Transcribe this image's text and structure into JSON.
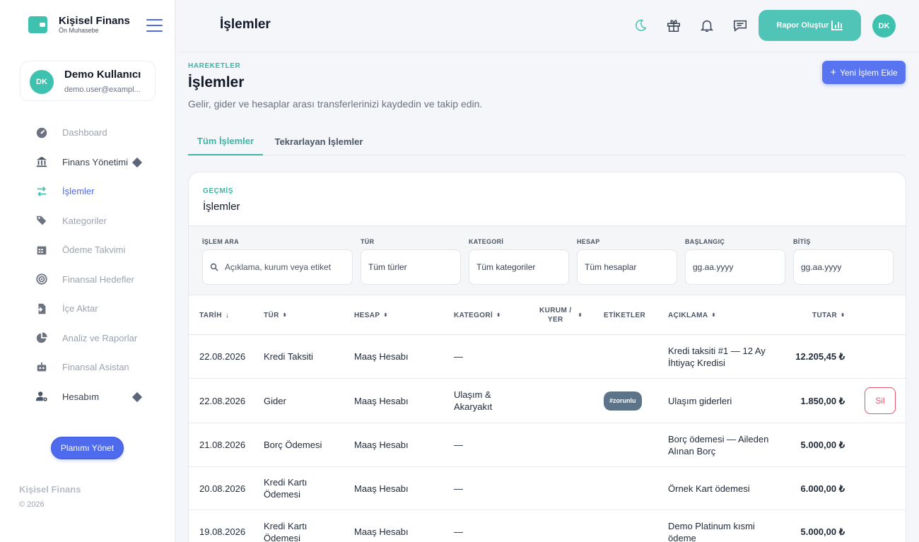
{
  "brand": {
    "name": "Kişisel Finans",
    "subtitle": "Ön Muhasebe"
  },
  "profile": {
    "initials": "DK",
    "name": "Demo Kullanıcı",
    "email": "demo.user@exampl..."
  },
  "nav": [
    {
      "label": "Dashboard",
      "icon": "dashboard-icon"
    },
    {
      "label": "Finans Yönetimi",
      "icon": "bank-icon",
      "has_submenu": true
    },
    {
      "label": "İşlemler",
      "icon": "transfer-icon",
      "active": true
    },
    {
      "label": "Kategoriler",
      "icon": "tags-icon"
    },
    {
      "label": "Ödeme Takvimi",
      "icon": "calendar-icon"
    },
    {
      "label": "Finansal Hedefler",
      "icon": "target-icon"
    },
    {
      "label": "İçe Aktar",
      "icon": "import-icon"
    },
    {
      "label": "Analiz ve Raporlar",
      "icon": "pie-chart-icon"
    },
    {
      "label": "Finansal Asistan",
      "icon": "robot-icon"
    },
    {
      "label": "Hesabım",
      "icon": "user-cog-icon",
      "has_submenu": true
    }
  ],
  "plan_button": "Planımı Yönet",
  "footer": {
    "brand": "Kişisel Finans",
    "copyright": "© 2026"
  },
  "topbar": {
    "title": "İşlemler",
    "icons": [
      "moon-icon",
      "gift-icon",
      "bell-icon",
      "chat-icon"
    ],
    "report_button": "Rapor Oluştur",
    "avatar": "DK"
  },
  "header": {
    "eyebrow": "HAREKETLER",
    "title": "İşlemler",
    "subtitle": "Gelir, gider ve hesaplar arası transferlerinizi kaydedin ve takip edin.",
    "add_button": "Yeni İşlem Ekle"
  },
  "tabs": [
    {
      "label": "Tüm İşlemler",
      "active": true
    },
    {
      "label": "Tekrarlayan İşlemler",
      "active": false
    }
  ],
  "card": {
    "eyebrow": "GEÇMİŞ",
    "title": "İşlemler"
  },
  "filters": {
    "search": {
      "label": "İŞLEM ARA",
      "placeholder": "Açıklama, kurum veya etiket"
    },
    "type": {
      "label": "TÜR",
      "value": "Tüm türler"
    },
    "category": {
      "label": "KATEGORİ",
      "value": "Tüm kategoriler"
    },
    "account": {
      "label": "HESAP",
      "value": "Tüm hesaplar"
    },
    "start": {
      "label": "BAŞLANGIÇ",
      "value": "gg.aa.yyyy"
    },
    "end": {
      "label": "BİTİŞ",
      "value": "gg.aa.yyyy"
    }
  },
  "table": {
    "columns": {
      "date": "TARİH",
      "type": "TÜR",
      "account": "HESAP",
      "category": "KATEGORİ",
      "place_line1": "KURUM /",
      "place_line2": "YER",
      "tags": "ETİKETLER",
      "description": "AÇIKLAMA",
      "amount": "TUTAR"
    },
    "sort_icon": "⬍",
    "sort_desc_icon": "↓",
    "rows": [
      {
        "date": "22.08.2026",
        "type": "Kredi Taksiti",
        "account": "Maaş Hesabı",
        "category": "—",
        "tag": "",
        "description": "Kredi taksiti #1 — 12 Ay İhtiyaç Kredisi",
        "amount": "12.205,45 ₺"
      },
      {
        "date": "22.08.2026",
        "type": "Gider",
        "account": "Maaş Hesabı",
        "category": "Ulaşım & Akaryakıt",
        "tag": "#zorunlu",
        "description": "Ulaşım giderleri",
        "amount": "1.850,00 ₺",
        "delete": "Sil"
      },
      {
        "date": "21.08.2026",
        "type": "Borç Ödemesi",
        "account": "Maaş Hesabı",
        "category": "—",
        "tag": "",
        "description": "Borç ödemesi — Aileden Alınan Borç",
        "amount": "5.000,00 ₺"
      },
      {
        "date": "20.08.2026",
        "type": "Kredi Kartı Ödemesi",
        "account": "Maaş Hesabı",
        "category": "—",
        "tag": "",
        "description": "Örnek Kart ödemesi",
        "amount": "6.000,00 ₺"
      },
      {
        "date": "19.08.2026",
        "type": "Kredi Kartı Ödemesi",
        "account": "Maaş Hesabı",
        "category": "—",
        "tag": "",
        "description": "Demo Platinum kısmi ödeme",
        "amount": "5.000,00 ₺"
      }
    ]
  },
  "colors": {
    "accent": "#3fb3a5",
    "primary": "#4f6bed",
    "danger": "#e0566b",
    "tag": "#5d7488"
  }
}
